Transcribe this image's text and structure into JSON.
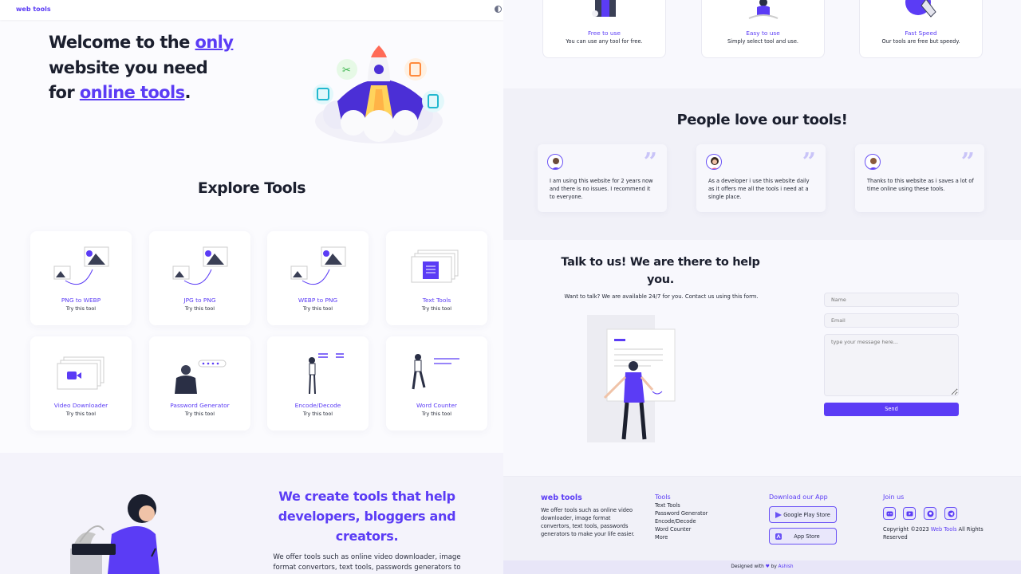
{
  "header": {
    "brand": "web tools"
  },
  "hero": {
    "line1_prefix": "Welcome to the ",
    "line1_highlight": "only",
    "line2": "website you need",
    "line3_prefix": "for ",
    "line3_highlight": "online tools",
    "line3_suffix": "."
  },
  "explore": {
    "title": "Explore Tools",
    "try_label": "Try this tool",
    "tools": [
      {
        "name": "PNG to WEBP"
      },
      {
        "name": "JPG to PNG"
      },
      {
        "name": "WEBP to PNG"
      },
      {
        "name": "Text Tools"
      },
      {
        "name": "Video Downloader"
      },
      {
        "name": "Password Generator"
      },
      {
        "name": "Encode/Decode"
      },
      {
        "name": "Word Counter"
      }
    ]
  },
  "about": {
    "title": "We create tools that help developers, bloggers and creators.",
    "text": "We offer tools such as online video downloader, image format convertors, text tools, passwords generators to"
  },
  "features": [
    {
      "title": "Free to use",
      "text": "You can use any tool for free."
    },
    {
      "title": "Easy to use",
      "text": "Simply select tool and use."
    },
    {
      "title": "Fast Speed",
      "text": "Our tools are free but speedy."
    }
  ],
  "testimonials": {
    "title": "People love our tools!",
    "items": [
      {
        "text": "I am using this website for 2 years now and there is no issues. I recommend it to everyone."
      },
      {
        "text": "As a developer i use this website daily as it offers me all the tools i need at a single place."
      },
      {
        "text": "Thanks to this website as i saves a lot of time online using these tools."
      }
    ]
  },
  "contact": {
    "title": "Talk to us! We are there to help you.",
    "subtitle": "Want to talk? We are available 24/7 for you. Contact us using this form.",
    "name_placeholder": "Name",
    "email_placeholder": "Email",
    "message_placeholder": "type your message here...",
    "send_label": "Send"
  },
  "footer": {
    "brand": "web tools",
    "description": "We offer tools such as online video downloader, image format convertors, text tools, passwords generators to make your life easier.",
    "tools_title": "Tools",
    "tools_links": [
      "Text Tools",
      "Password Generator",
      "Encode/Decode",
      "Word Counter",
      "More"
    ],
    "app_title": "Download our App",
    "google_play": "Google Play Store",
    "app_store": "App Store",
    "join_title": "Join us",
    "copyright_prefix": "Copyright ©2023 ",
    "copyright_link": "Web Tools",
    "copyright_suffix": " All Rights Reserved",
    "designed_prefix": "Designed with ",
    "designed_by": " by ",
    "designed_author": "Ashish"
  },
  "colors": {
    "accent": "#5b3cf5",
    "dark": "#1b1f2e",
    "band": "#f4f3fb"
  },
  "icons": [
    "theme-toggle-icon",
    "rocket-icon",
    "discord-icon",
    "youtube-icon",
    "github-icon",
    "telegram-icon",
    "heart-icon",
    "play-store-icon",
    "app-store-icon"
  ]
}
